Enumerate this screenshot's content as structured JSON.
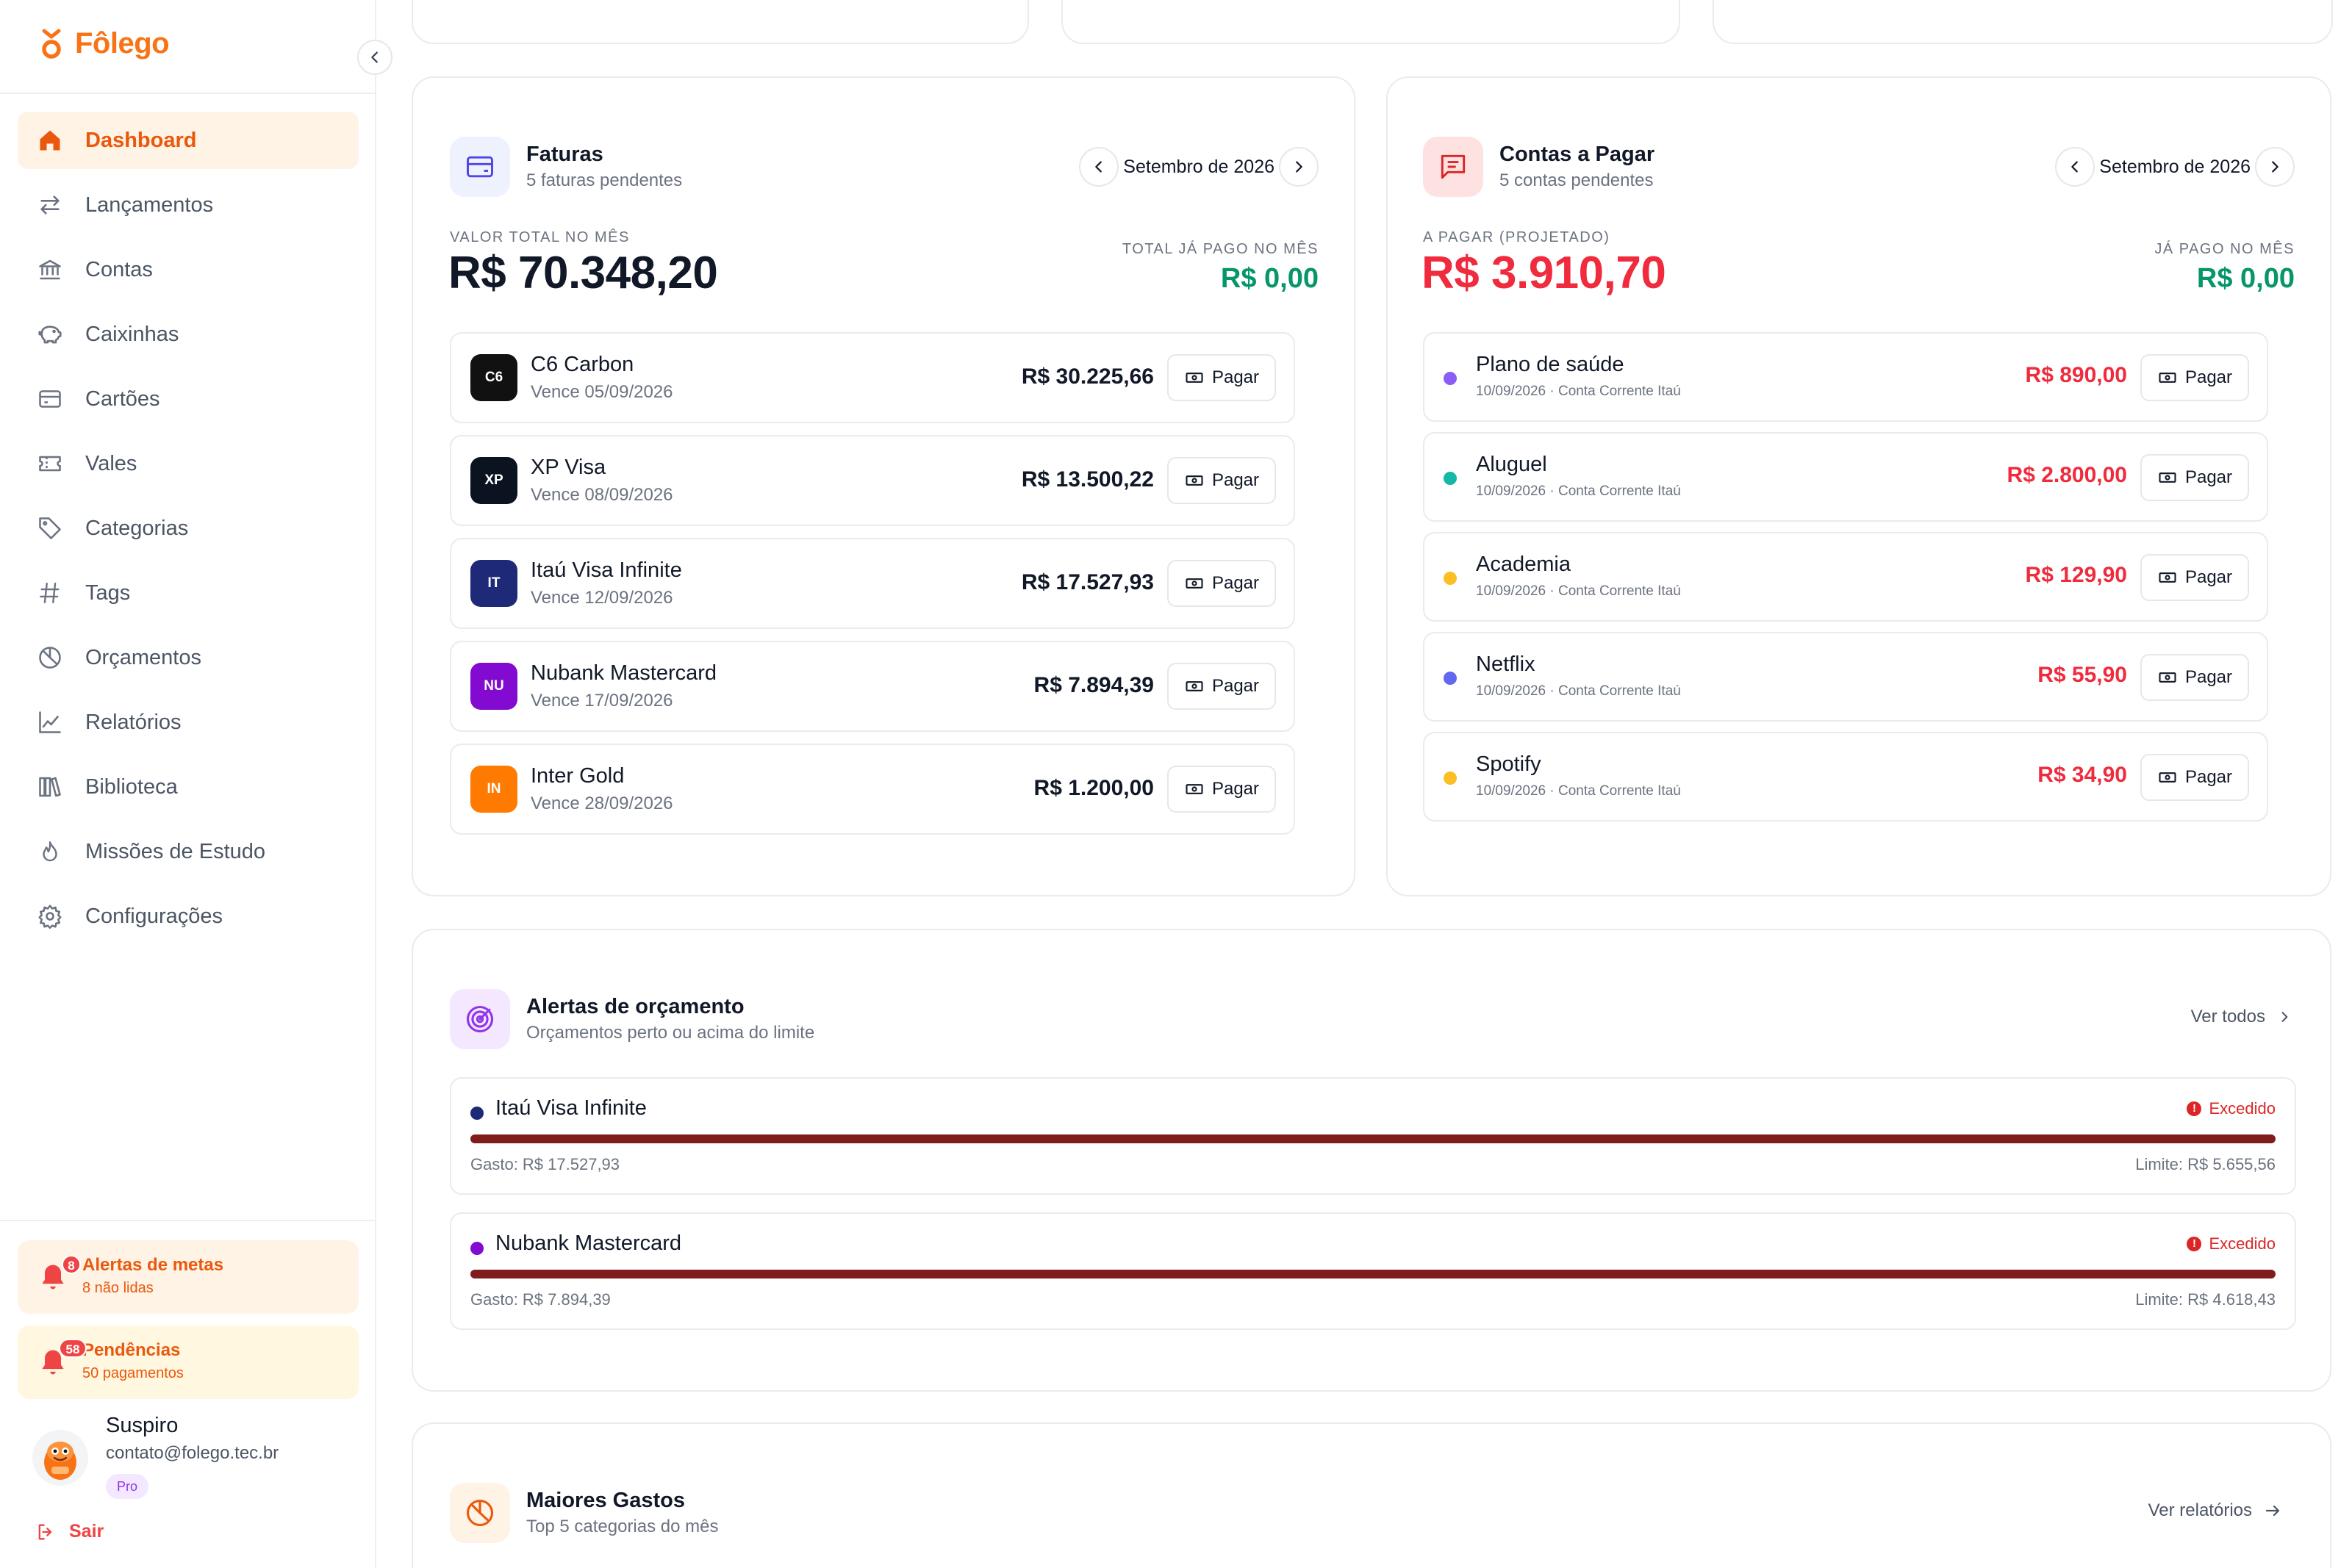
{
  "app": {
    "name": "Fôlego"
  },
  "colors": {
    "brand": "#f97316",
    "danger": "#ef2b3d",
    "success": "#059669",
    "exceeded_bar": "#7f1d1d"
  },
  "sidebar": {
    "items": [
      {
        "label": "Dashboard",
        "icon": "home-icon",
        "active": true
      },
      {
        "label": "Lançamentos",
        "icon": "arrows-left-right-icon"
      },
      {
        "label": "Contas",
        "icon": "bank-icon"
      },
      {
        "label": "Caixinhas",
        "icon": "piggy-bank-icon"
      },
      {
        "label": "Cartões",
        "icon": "credit-card-icon"
      },
      {
        "label": "Vales",
        "icon": "ticket-icon"
      },
      {
        "label": "Categorias",
        "icon": "tag-icon"
      },
      {
        "label": "Tags",
        "icon": "hash-icon"
      },
      {
        "label": "Orçamentos",
        "icon": "pie-chart-icon"
      },
      {
        "label": "Relatórios",
        "icon": "line-chart-icon"
      },
      {
        "label": "Biblioteca",
        "icon": "library-icon"
      },
      {
        "label": "Missões de Estudo",
        "icon": "flame-icon"
      },
      {
        "label": "Configurações",
        "icon": "gear-icon"
      }
    ],
    "goal_alerts": {
      "title": "Alertas de metas",
      "subtitle": "8 não lidas",
      "badge": "8"
    },
    "pending": {
      "title": "Pendências",
      "subtitle": "50 pagamentos",
      "badge": "58"
    },
    "user": {
      "name": "Suspiro",
      "email": "contato@folego.tec.br",
      "plan": "Pro"
    },
    "logout_label": "Sair"
  },
  "invoices": {
    "title": "Faturas",
    "subtitle": "5 faturas pendentes",
    "month": "Setembro de 2026",
    "total_label": "VALOR TOTAL NO MÊS",
    "total_value": "R$ 70.348,20",
    "paid_label": "TOTAL JÁ PAGO NO MÊS",
    "paid_value": "R$ 0,00",
    "pay_label": "Pagar",
    "rows": [
      {
        "badge": "C6",
        "badge_color": "#111111",
        "name": "C6 Carbon",
        "due": "Vence 05/09/2026",
        "amount": "R$ 30.225,66"
      },
      {
        "badge": "XP",
        "badge_color": "#0b1220",
        "name": "XP Visa",
        "due": "Vence 08/09/2026",
        "amount": "R$ 13.500,22"
      },
      {
        "badge": "IT",
        "badge_color": "#1e2a78",
        "name": "Itaú Visa Infinite",
        "due": "Vence 12/09/2026",
        "amount": "R$ 17.527,93"
      },
      {
        "badge": "NU",
        "badge_color": "#820ad1",
        "name": "Nubank Mastercard",
        "due": "Vence 17/09/2026",
        "amount": "R$ 7.894,39"
      },
      {
        "badge": "IN",
        "badge_color": "#ff7a00",
        "name": "Inter Gold",
        "due": "Vence 28/09/2026",
        "amount": "R$ 1.200,00"
      }
    ]
  },
  "bills": {
    "title": "Contas a Pagar",
    "subtitle": "5 contas pendentes",
    "month": "Setembro de 2026",
    "total_label": "A PAGAR (PROJETADO)",
    "total_value": "R$ 3.910,70",
    "paid_label": "JÁ PAGO NO MÊS",
    "paid_value": "R$ 0,00",
    "pay_label": "Pagar",
    "rows": [
      {
        "dot": "#8b5cf6",
        "name": "Plano de saúde",
        "meta": "10/09/2026 · Conta Corrente Itaú",
        "amount": "R$ 890,00"
      },
      {
        "dot": "#14b8a6",
        "name": "Aluguel",
        "meta": "10/09/2026 · Conta Corrente Itaú",
        "amount": "R$ 2.800,00"
      },
      {
        "dot": "#fbbf24",
        "name": "Academia",
        "meta": "10/09/2026 · Conta Corrente Itaú",
        "amount": "R$ 129,90"
      },
      {
        "dot": "#6366f1",
        "name": "Netflix",
        "meta": "10/09/2026 · Conta Corrente Itaú",
        "amount": "R$ 55,90"
      },
      {
        "dot": "#fbbf24",
        "name": "Spotify",
        "meta": "10/09/2026 · Conta Corrente Itaú",
        "amount": "R$ 34,90"
      }
    ]
  },
  "budget_alerts": {
    "title": "Alertas de orçamento",
    "subtitle": "Orçamentos perto ou acima do limite",
    "see_all": "Ver todos",
    "rows": [
      {
        "dot": "#1e2a78",
        "name": "Itaú Visa Infinite",
        "status": "Excedido",
        "spent": "Gasto: R$ 17.527,93",
        "limit": "Limite: R$ 5.655,56",
        "progress": 1.0
      },
      {
        "dot": "#820ad1",
        "name": "Nubank Mastercard",
        "status": "Excedido",
        "spent": "Gasto: R$ 7.894,39",
        "limit": "Limite: R$ 4.618,43",
        "progress": 1.0
      }
    ]
  },
  "top_spending": {
    "title": "Maiores Gastos",
    "subtitle": "Top 5 categorias do mês",
    "see_reports": "Ver relatórios"
  }
}
